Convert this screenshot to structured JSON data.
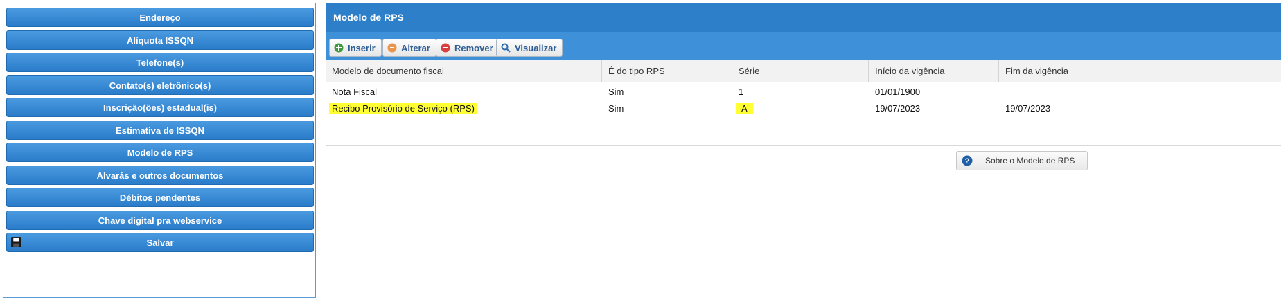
{
  "sidebar": {
    "items": [
      {
        "label": "Endereço"
      },
      {
        "label": "Alíquota ISSQN"
      },
      {
        "label": "Telefone(s)"
      },
      {
        "label": "Contato(s) eletrônico(s)"
      },
      {
        "label": "Inscrição(ões) estadual(is)"
      },
      {
        "label": "Estimativa de ISSQN"
      },
      {
        "label": "Modelo de RPS"
      },
      {
        "label": "Alvarás e outros documentos"
      },
      {
        "label": "Débitos pendentes"
      },
      {
        "label": "Chave digital pra webservice"
      }
    ],
    "save_label": "Salvar"
  },
  "panel": {
    "title": "Modelo de RPS",
    "toolbar": {
      "insert": "Inserir",
      "edit": "Alterar",
      "remove": "Remover",
      "view": "Visualizar"
    },
    "table": {
      "columns": [
        "Modelo de documento fiscal",
        "É do tipo RPS",
        "Série",
        "Início da vigência",
        "Fim da vigência"
      ],
      "rows": [
        [
          "Nota Fiscal",
          "Sim",
          "1",
          "01/01/1900",
          ""
        ],
        [
          "Recibo Provisório de Serviço (RPS)",
          "Sim",
          "A",
          "19/07/2023",
          "19/07/2023"
        ]
      ]
    },
    "about_label": "Sobre o Modelo de RPS"
  },
  "colors": {
    "accent": "#2d7fc9",
    "highlight": "#ffff33"
  }
}
